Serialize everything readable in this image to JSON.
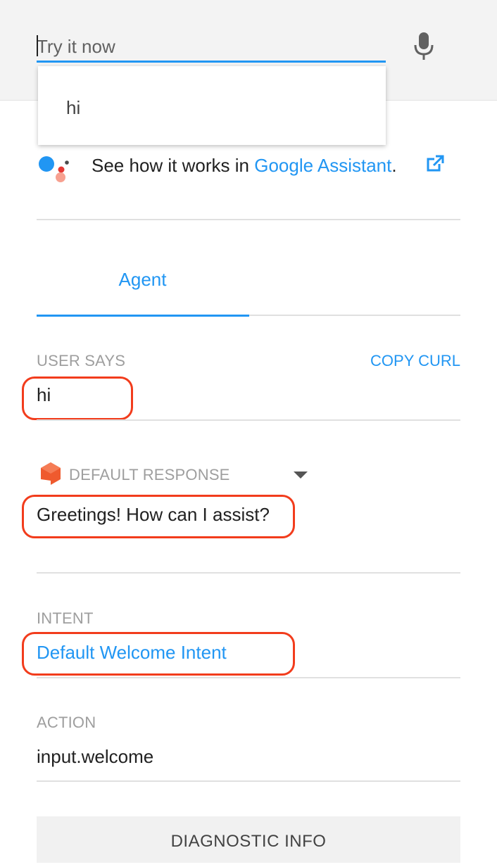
{
  "search": {
    "placeholder": "Try it now",
    "mic_icon": "microphone-icon",
    "suggestions": [
      "hi"
    ]
  },
  "assistant": {
    "text_prefix": "See how it works in ",
    "link_label": "Google Assistant",
    "text_suffix": ".",
    "logo": "google-assistant-logo",
    "external_icon": "external-link-icon"
  },
  "tabs": [
    {
      "label": "Agent",
      "selected": true
    }
  ],
  "user_says": {
    "label": "USER SAYS",
    "value": "hi",
    "copy_curl_label": "COPY CURL"
  },
  "default_response": {
    "label": "DEFAULT RESPONSE",
    "value": "Greetings! How can I assist?",
    "icon": "dialogflow-icon"
  },
  "intent": {
    "label": "INTENT",
    "value": "Default Welcome Intent"
  },
  "action": {
    "label": "ACTION",
    "value": "input.welcome"
  },
  "diagnostic": {
    "label": "DIAGNOSTIC INFO"
  },
  "colors": {
    "accent": "#2196f3",
    "highlight": "#f23c1c",
    "label_gray": "#9e9e9e",
    "dialogflow_orange": "#ef5a2e"
  }
}
